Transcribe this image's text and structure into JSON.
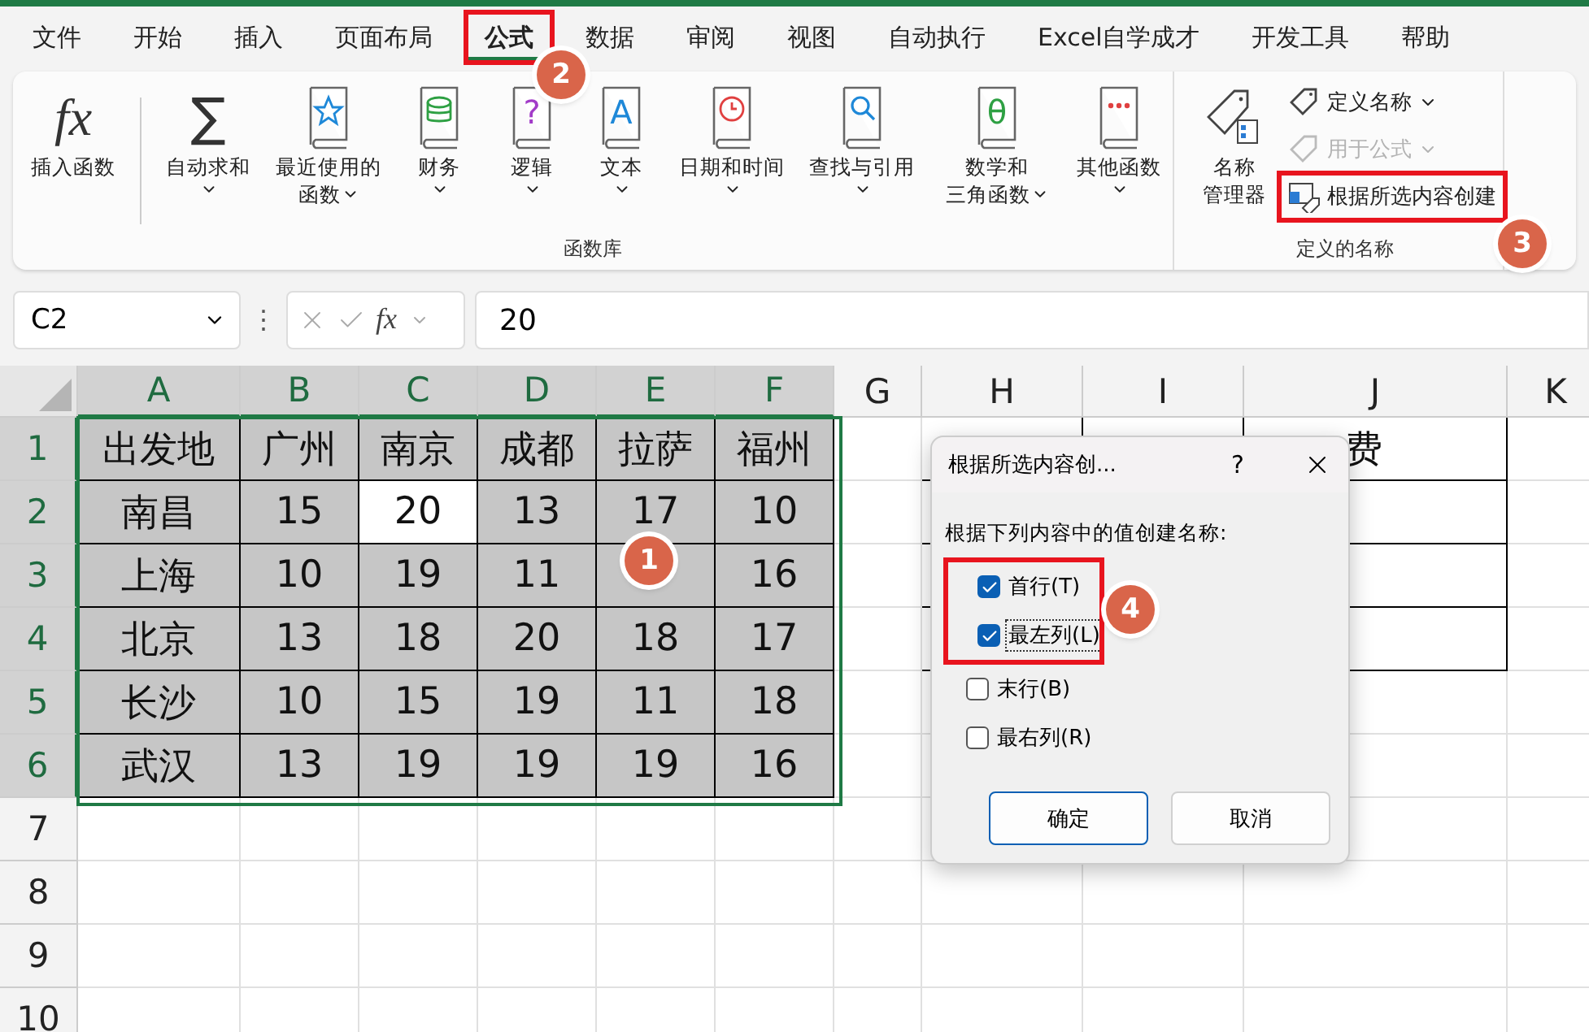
{
  "menu_tabs": [
    {
      "label": "文件",
      "selected": false,
      "framed": false
    },
    {
      "label": "开始",
      "selected": false,
      "framed": false
    },
    {
      "label": "插入",
      "selected": false,
      "framed": false
    },
    {
      "label": "页面布局",
      "selected": false,
      "framed": false
    },
    {
      "label": "公式",
      "selected": true,
      "framed": true
    },
    {
      "label": "数据",
      "selected": false,
      "framed": false
    },
    {
      "label": "审阅",
      "selected": false,
      "framed": false
    },
    {
      "label": "视图",
      "selected": false,
      "framed": false
    },
    {
      "label": "自动执行",
      "selected": false,
      "framed": false
    },
    {
      "label": "Excel自学成才",
      "selected": false,
      "framed": false
    },
    {
      "label": "开发工具",
      "selected": false,
      "framed": false
    },
    {
      "label": "帮助",
      "selected": false,
      "framed": false
    }
  ],
  "function_library": {
    "label": "函数库",
    "buttons": [
      {
        "kind": "fx",
        "glyph": "fx",
        "lines": [
          "插入函数"
        ],
        "has_menu": false
      },
      {
        "kind": "sum",
        "glyph": "∑",
        "lines": [
          "自动求和"
        ],
        "has_menu": true
      },
      {
        "kind": "star",
        "lines": [
          "最近使用的",
          "函数"
        ],
        "has_menu": true
      },
      {
        "kind": "stack",
        "lines": [
          "财务"
        ],
        "has_menu": true
      },
      {
        "kind": "glyph",
        "glyph": "?",
        "color": "#a23cc8",
        "lines": [
          "逻辑"
        ],
        "has_menu": true
      },
      {
        "kind": "glyph",
        "glyph": "A",
        "color": "#1e88d8",
        "lines": [
          "文本"
        ],
        "has_menu": true
      },
      {
        "kind": "clock",
        "lines": [
          "日期和时间"
        ],
        "has_menu": true
      },
      {
        "kind": "search",
        "lines": [
          "查找与引用"
        ],
        "has_menu": true
      },
      {
        "kind": "glyph",
        "glyph": "θ",
        "color": "#2ea043",
        "lines": [
          "数学和",
          "三角函数"
        ],
        "has_menu": true
      },
      {
        "kind": "dots",
        "lines": [
          "其他函数"
        ],
        "has_menu": true
      }
    ]
  },
  "defined_names": {
    "label": "定义的名称",
    "manager": {
      "lines": [
        "名称",
        "管理器"
      ]
    },
    "buttons": [
      {
        "kind": "tag",
        "label": "定义名称",
        "has_menu": true,
        "disabled": false,
        "highlighted": false
      },
      {
        "kind": "formula-tag",
        "label": "用于公式",
        "has_menu": true,
        "disabled": true,
        "highlighted": false
      },
      {
        "kind": "table-tag",
        "label": "根据所选内容创建",
        "has_menu": false,
        "disabled": false,
        "highlighted": true
      }
    ]
  },
  "formula_bar": {
    "name_box": "C2",
    "separator": "⋮",
    "fx": "fx",
    "value": "20"
  },
  "sheet": {
    "columns": [
      {
        "label": "A",
        "selected": true
      },
      {
        "label": "B",
        "selected": true
      },
      {
        "label": "C",
        "selected": true
      },
      {
        "label": "D",
        "selected": true
      },
      {
        "label": "E",
        "selected": true
      },
      {
        "label": "F",
        "selected": true
      },
      {
        "label": "G",
        "selected": false
      },
      {
        "label": "H",
        "selected": false
      },
      {
        "label": "I",
        "selected": false
      },
      {
        "label": "J",
        "selected": false
      },
      {
        "label": "K",
        "selected": false
      }
    ],
    "rows": [
      {
        "label": "1",
        "selected": true,
        "cells": [
          {
            "text": "出发地",
            "selected": true
          },
          {
            "text": "广州",
            "selected": true
          },
          {
            "text": "南京",
            "selected": true
          },
          {
            "text": "成都",
            "selected": true
          },
          {
            "text": "拉萨",
            "selected": true
          },
          {
            "text": "福州",
            "selected": true
          }
        ]
      },
      {
        "label": "2",
        "selected": true,
        "cells": [
          {
            "text": "南昌",
            "selected": true
          },
          {
            "text": "15",
            "selected": true
          },
          {
            "text": "20",
            "selected": false
          },
          {
            "text": "13",
            "selected": true
          },
          {
            "text": "17",
            "selected": true
          },
          {
            "text": "10",
            "selected": true
          }
        ]
      },
      {
        "label": "3",
        "selected": true,
        "cells": [
          {
            "text": "上海",
            "selected": true
          },
          {
            "text": "10",
            "selected": true
          },
          {
            "text": "19",
            "selected": true
          },
          {
            "text": "11",
            "selected": true
          },
          {
            "selected": true
          },
          {
            "text": "16",
            "selected": true
          }
        ]
      },
      {
        "label": "4",
        "selected": true,
        "cells": [
          {
            "text": "北京",
            "selected": true
          },
          {
            "text": "13",
            "selected": true
          },
          {
            "text": "18",
            "selected": true
          },
          {
            "text": "20",
            "selected": true
          },
          {
            "text": "18",
            "selected": true
          },
          {
            "text": "17",
            "selected": true
          }
        ]
      },
      {
        "label": "5",
        "selected": true,
        "cells": [
          {
            "text": "长沙",
            "selected": true
          },
          {
            "text": "10",
            "selected": true
          },
          {
            "text": "15",
            "selected": true
          },
          {
            "text": "19",
            "selected": true
          },
          {
            "text": "11",
            "selected": true
          },
          {
            "text": "18",
            "selected": true
          }
        ]
      },
      {
        "label": "6",
        "selected": true,
        "cells": [
          {
            "text": "武汉",
            "selected": true
          },
          {
            "text": "13",
            "selected": true
          },
          {
            "text": "19",
            "selected": true
          },
          {
            "text": "19",
            "selected": true
          },
          {
            "text": "19",
            "selected": true
          },
          {
            "text": "16",
            "selected": true
          }
        ]
      },
      {
        "label": "7",
        "selected": false,
        "cells": []
      },
      {
        "label": "8",
        "selected": false,
        "cells": []
      },
      {
        "label": "9",
        "selected": false,
        "cells": []
      },
      {
        "label": "10",
        "selected": false,
        "cells": []
      }
    ],
    "column_j_header_fragment": "费"
  },
  "dialog": {
    "title": "根据所选内容创...",
    "help": "?",
    "prompt": "根据下列内容中的值创建名称:",
    "options": [
      {
        "label": "首行(T)",
        "checked": true,
        "focused": false,
        "framed": true
      },
      {
        "label": "最左列(L)",
        "checked": true,
        "focused": true,
        "framed": true
      },
      {
        "label": "末行(B)",
        "checked": false,
        "focused": false,
        "framed": false
      },
      {
        "label": "最右列(R)",
        "checked": false,
        "focused": false,
        "framed": false
      }
    ],
    "buttons": [
      {
        "label": "确定",
        "default": true
      },
      {
        "label": "取消",
        "default": false
      }
    ]
  },
  "callouts": [
    "1",
    "2",
    "3",
    "4"
  ]
}
